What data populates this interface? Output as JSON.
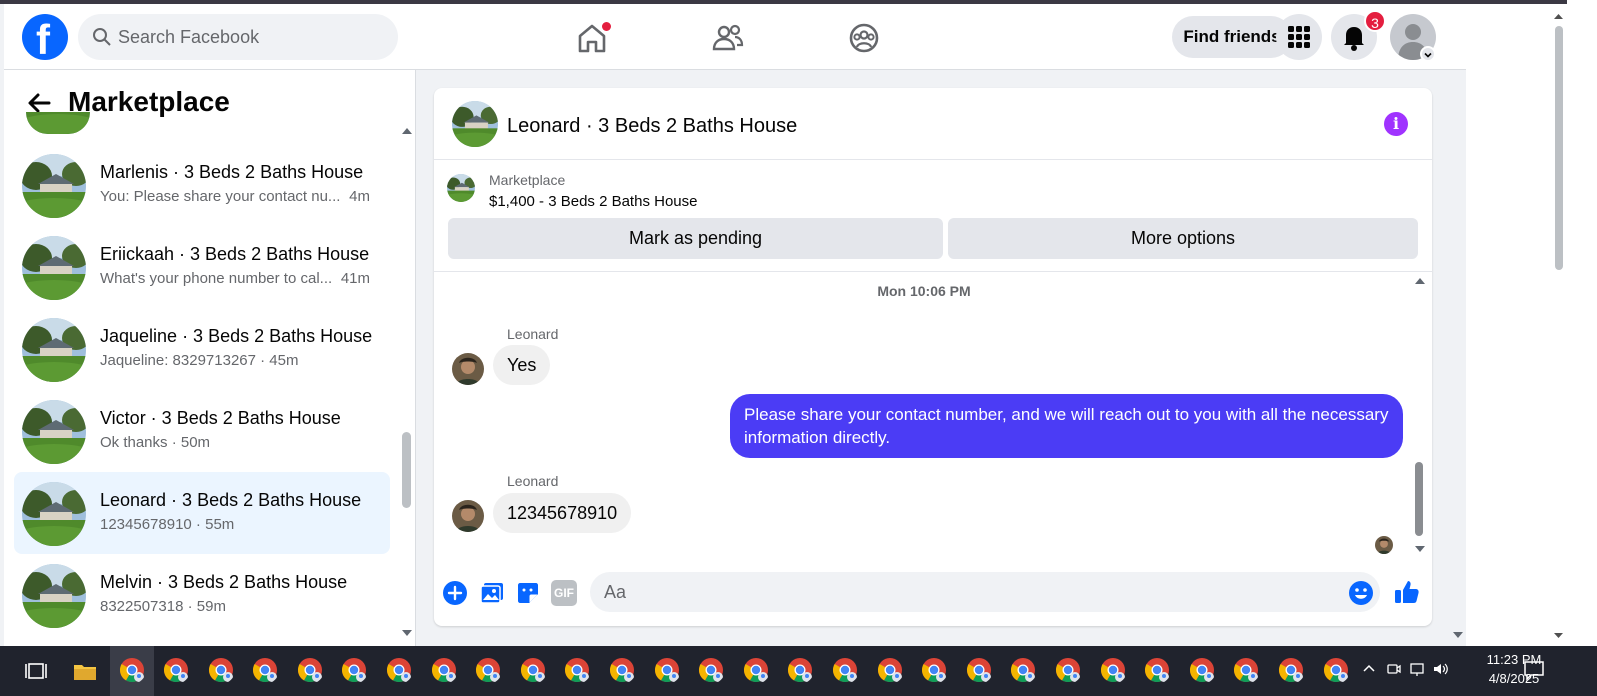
{
  "header": {
    "logo_letter": "f",
    "search_placeholder": "Search Facebook",
    "find_friends": "Find friends",
    "notifications_count": "3"
  },
  "sidebar": {
    "title": "Marketplace",
    "conversations": [
      {
        "name": "Marlenis · 3 Beds 2 Baths House",
        "preview": "You: Please share your contact nu...",
        "time": "4m"
      },
      {
        "name": "Eriickaah · 3 Beds 2 Baths House",
        "preview": "What's your phone number to cal...",
        "time": "41m"
      },
      {
        "name": "Jaqueline · 3 Beds 2 Baths House",
        "preview": "Jaqueline: 8329713267 · 45m",
        "time": ""
      },
      {
        "name": "Victor · 3 Beds 2 Baths House",
        "preview": "Ok thanks · 50m",
        "time": ""
      },
      {
        "name": "Leonard · 3 Beds 2 Baths House",
        "preview": "12345678910 · 55m",
        "time": ""
      },
      {
        "name": "Melvin · 3 Beds 2 Baths House",
        "preview": "8322507318 · 59m",
        "time": ""
      }
    ]
  },
  "chat": {
    "title": "Leonard · 3 Beds 2 Baths House",
    "listing_source": "Marketplace",
    "listing_price": "$1,400 - 3 Beds 2 Baths House",
    "mark_pending": "Mark as pending",
    "more_options": "More options",
    "timestamp": "Mon 10:06 PM",
    "messages": [
      {
        "sender": "Leonard",
        "text": "Yes"
      },
      {
        "text": "Please share your contact number, and we will reach out to you with all the necessary information directly."
      },
      {
        "sender": "Leonard",
        "text": "12345678910"
      }
    ],
    "composer_placeholder": "Aa",
    "gif_label": "GIF"
  },
  "taskbar": {
    "time": "11:23 PM",
    "date": "4/8/2025"
  },
  "colors": {
    "fb_blue": "#0866ff",
    "outgoing_bubble": "#4b3cf5",
    "notification_red": "#e41e3f",
    "active_row": "#ebf5ff",
    "info_purple": "#a033ff"
  }
}
